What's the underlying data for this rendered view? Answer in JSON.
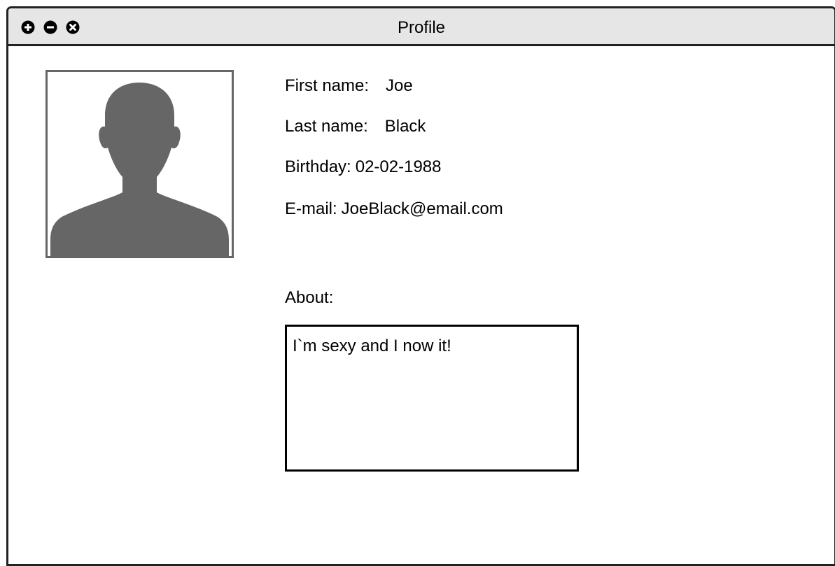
{
  "window": {
    "title": "Profile",
    "controls": [
      {
        "icon": "plus-circle-icon",
        "action": "maximize"
      },
      {
        "icon": "minus-circle-icon",
        "action": "minimize"
      },
      {
        "icon": "close-circle-icon",
        "action": "close"
      }
    ]
  },
  "profile": {
    "avatar_icon": "user-silhouette-icon",
    "first_name_label": "First name:",
    "first_name": "Joe",
    "last_name_label": "Last name:",
    "last_name": "Black",
    "birthday_label": "Birthday:",
    "birthday": "02-02-1988",
    "email_label": "E-mail:",
    "email": "JoeBlack@email.com",
    "about_label": "About:",
    "about_text": "I`m sexy and I now it!"
  },
  "colors": {
    "titlebar_bg": "#e6e6e6",
    "border": "#222222",
    "avatar_fill": "#666666"
  }
}
